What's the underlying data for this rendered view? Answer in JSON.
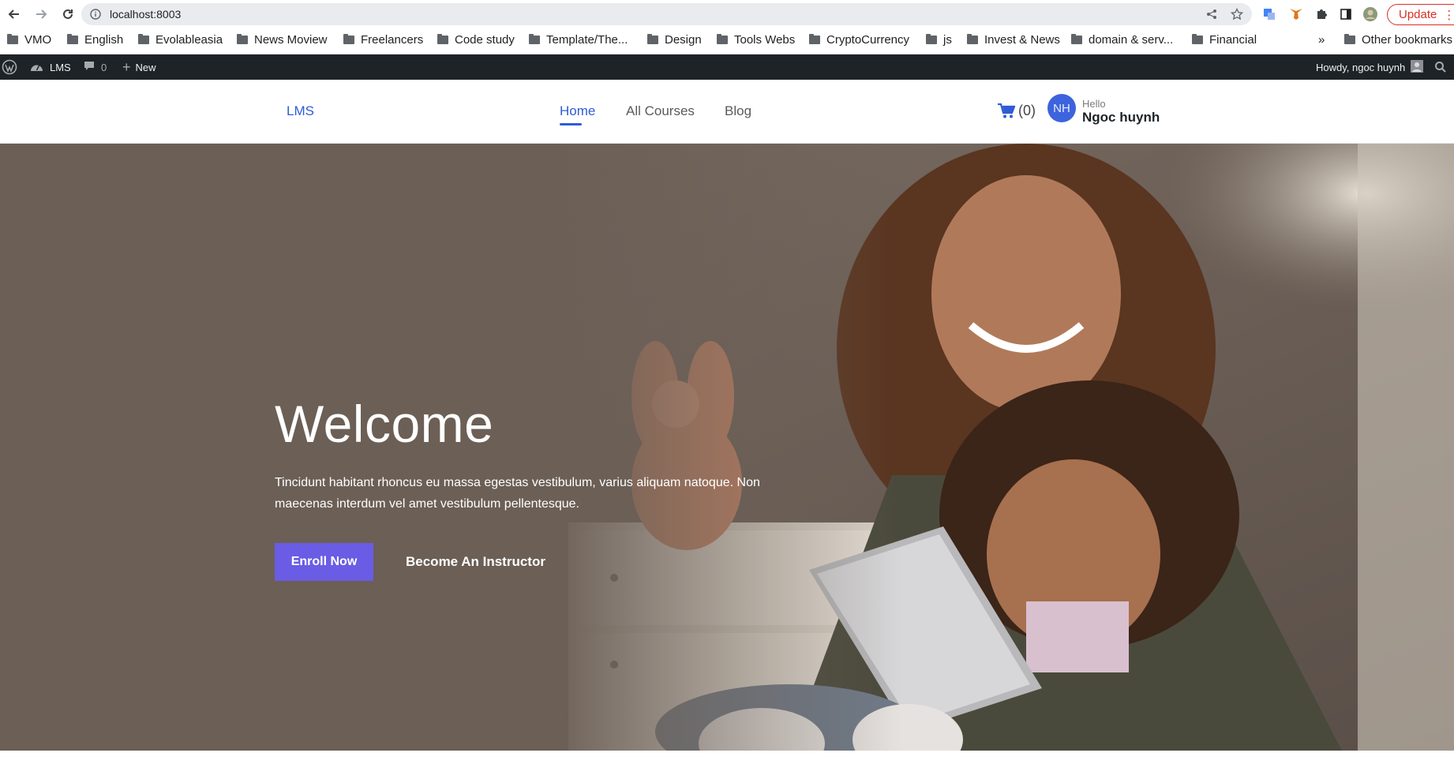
{
  "browser": {
    "url": "localhost:8003",
    "update_label": "Update",
    "bookmarks": [
      "VMO",
      "English",
      "Evolableasia",
      "News Moview",
      "Freelancers",
      "Code study",
      "Template/The...",
      "Design",
      "Tools Webs",
      "CryptoCurrency",
      "js",
      "Invest & News",
      "domain & serv...",
      "Financial"
    ],
    "more_label": "»",
    "other_bookmarks": "Other bookmarks"
  },
  "adminbar": {
    "site_name": "LMS",
    "comments_count": "0",
    "new_label": "New",
    "howdy": "Howdy, ngoc huynh"
  },
  "header": {
    "logo": "LMS",
    "nav": [
      "Home",
      "All Courses",
      "Blog"
    ],
    "active_nav": "Home",
    "cart_count": "(0)",
    "avatar_initials": "NH",
    "hello": "Hello",
    "user_name": "Ngoc huynh"
  },
  "hero": {
    "title": "Welcome",
    "text": "Tincidunt habitant rhoncus eu massa egestas vestibulum, varius aliquam natoque. Non maecenas interdum vel amet vestibulum pellentesque.",
    "primary_button": "Enroll Now",
    "secondary_button": "Become An Instructor"
  },
  "colors": {
    "accent": "#2f5cd6",
    "button": "#6a5ce4",
    "adminbar": "#1d2327",
    "hero_bg": "#6b5f56"
  }
}
